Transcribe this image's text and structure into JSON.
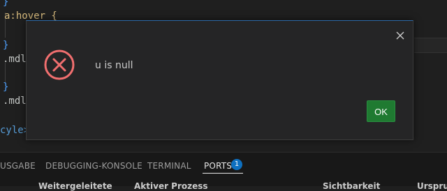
{
  "editor": {
    "lines": [
      {
        "text": "}",
        "cls": "tok-brace"
      },
      {
        "text": "a:hover {",
        "cls": "tok-sel"
      },
      {
        "text": "}",
        "cls": "tok-brace"
      },
      {
        "text": ".mdl",
        "cls": "tok-cls"
      },
      {
        "text": "}",
        "cls": "tok-brace"
      },
      {
        "text": ".mdl",
        "cls": "tok-cls"
      },
      {
        "text": "cyle>",
        "cls": "tok-tag"
      }
    ]
  },
  "dialog": {
    "message": "u is null",
    "ok_label": "OK",
    "icon": "error-circle-x-icon",
    "close_icon": "close-icon"
  },
  "panel": {
    "tabs": [
      {
        "label": "USGABE"
      },
      {
        "label": "DEBUGGING-KONSOLE"
      },
      {
        "label": "TERMINAL"
      },
      {
        "label": "PORTS",
        "active": true,
        "badge": "1"
      }
    ],
    "columns": [
      "Weitergeleitete",
      "Aktiver Prozess",
      "Sichtbarkeit",
      "Ursprung"
    ]
  },
  "colors": {
    "ok_button": "#1f7a31",
    "error_icon": "#f16f6f",
    "badge": "#0e70c0",
    "modal_bg": "#252526"
  }
}
